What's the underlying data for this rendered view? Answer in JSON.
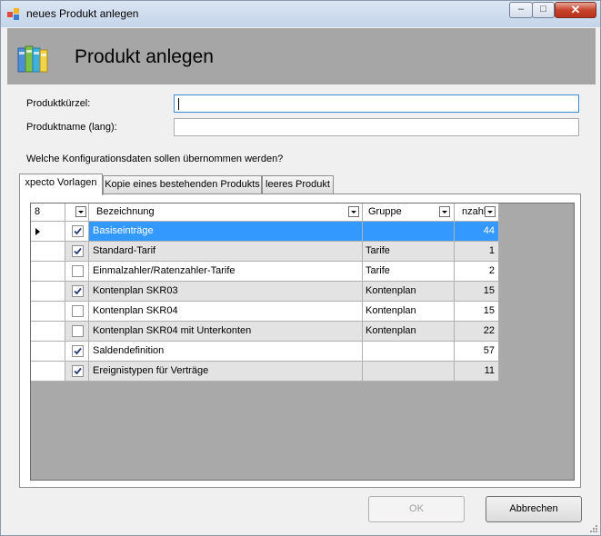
{
  "window": {
    "title": "neues Produkt anlegen",
    "close_glyph": "✕",
    "minimize_glyph": "–",
    "maximize_glyph": "□"
  },
  "header": {
    "title": "Produkt anlegen"
  },
  "form": {
    "short_name_label": "Produktkürzel:",
    "short_name_value": "",
    "long_name_label": "Produktname (lang):",
    "long_name_value": "",
    "question": "Welche Konfigurationsdaten sollen übernommen werden?"
  },
  "tabs": [
    {
      "label": "xpecto Vorlagen",
      "active": true
    },
    {
      "label": "Kopie eines bestehenden Produkts",
      "active": false
    },
    {
      "label": "leeres Produkt",
      "active": false
    }
  ],
  "grid": {
    "columns": {
      "rowheader": "8",
      "check": "",
      "bezeichnung": "Bezeichnung",
      "gruppe": "Gruppe",
      "anzahl": "nzahl"
    },
    "rows": [
      {
        "checked": true,
        "bezeichnung": "Basiseinträge",
        "gruppe": "",
        "anzahl": "44",
        "selected": true
      },
      {
        "checked": true,
        "bezeichnung": "Standard-Tarif",
        "gruppe": "Tarife",
        "anzahl": "1"
      },
      {
        "checked": false,
        "bezeichnung": "Einmalzahler/Ratenzahler-Tarife",
        "gruppe": "Tarife",
        "anzahl": "2"
      },
      {
        "checked": true,
        "bezeichnung": "Kontenplan SKR03",
        "gruppe": "Kontenplan",
        "anzahl": "15"
      },
      {
        "checked": false,
        "bezeichnung": "Kontenplan SKR04",
        "gruppe": "Kontenplan",
        "anzahl": "15"
      },
      {
        "checked": false,
        "bezeichnung": "Kontenplan SKR04 mit Unterkonten",
        "gruppe": "Kontenplan",
        "anzahl": "22"
      },
      {
        "checked": true,
        "bezeichnung": "Saldendefinition",
        "gruppe": "",
        "anzahl": "57"
      },
      {
        "checked": true,
        "bezeichnung": "Ereignistypen für Verträge",
        "gruppe": "",
        "anzahl": "11"
      }
    ]
  },
  "buttons": {
    "ok": "OK",
    "cancel": "Abbrechen"
  },
  "colors": {
    "selection": "#3399ff",
    "header_band": "#a6a6a6",
    "grid_background": "#a9a9a9"
  },
  "icons": [
    "window-app-icon",
    "folders-icon",
    "dropdown-arrow-icon",
    "row-pointer-icon",
    "checkbox-check-icon",
    "resize-grip-icon"
  ]
}
